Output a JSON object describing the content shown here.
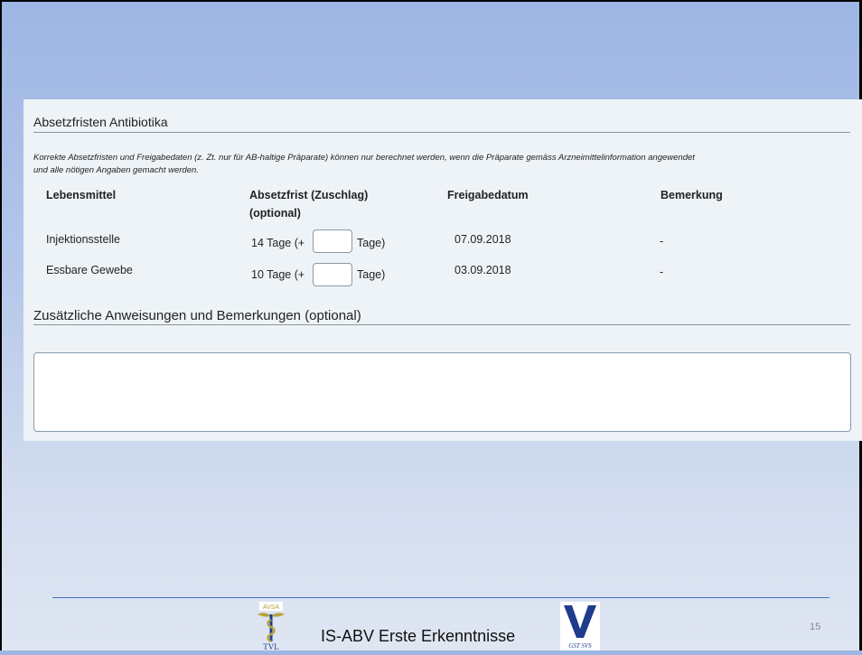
{
  "section_antibiotics": {
    "title": "Absetzfristen Antibiotika",
    "note_line1": "Korrekte Absetzfristen und Freigabedaten (z. Zt. nur für AB-haltige Präparate) können nur berechnet werden, wenn die Präparate gemäss Arzneimittelinformation angewendet",
    "note_line2": "und alle nötigen Angaben gemacht werden."
  },
  "table": {
    "headers": {
      "col1": "Lebensmittel",
      "col2_line1": "Absetzfrist (Zuschlag)",
      "col2_line2": "(optional)",
      "col3": "Freigabedatum",
      "col4": "Bemerkung"
    },
    "rows": [
      {
        "food": "Injektionsstelle",
        "period_prefix": "14 Tage (+",
        "period_suffix": "Tage)",
        "surcharge_value": "",
        "release_date": "07.09.2018",
        "remark": "-"
      },
      {
        "food": "Essbare Gewebe",
        "period_prefix": "10 Tage (+",
        "period_suffix": "Tage)",
        "surcharge_value": "",
        "release_date": "03.09.2018",
        "remark": "-"
      }
    ]
  },
  "section_remarks": {
    "title": "Zusätzliche Anweisungen und Bemerkungen (optional)",
    "value": ""
  },
  "footer": {
    "title": "IS-ABV Erste Erkenntnisse",
    "page_number": "15",
    "logo_left_text_top": "AVSA",
    "logo_left_text_bottom": "TVL",
    "logo_right_text": "GST SVS"
  },
  "colors": {
    "accent_line": "#4472c4",
    "panel_bg": "#eef3f7",
    "logo_gold": "#b8a23a",
    "logo_navy": "#1f3b8c"
  }
}
